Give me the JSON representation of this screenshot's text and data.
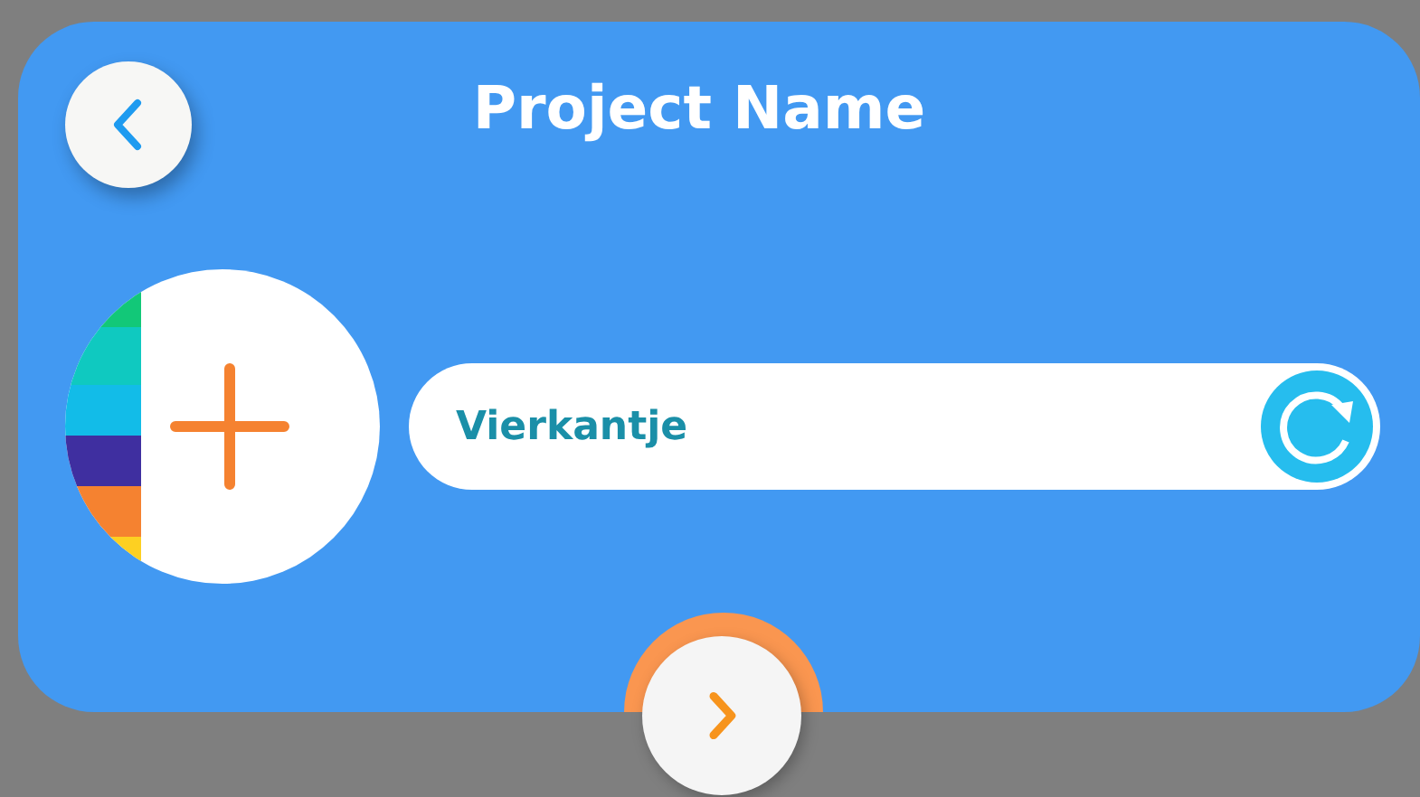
{
  "title": "Project Name",
  "name_field": {
    "value": "Vierkantje"
  }
}
